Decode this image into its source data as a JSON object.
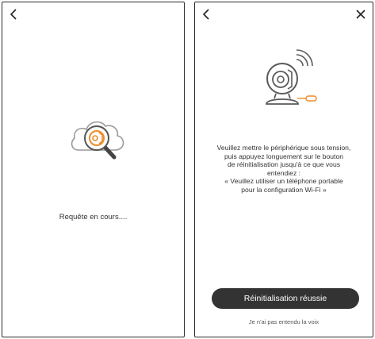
{
  "left_screen": {
    "status_text": "Requête en cours...."
  },
  "right_screen": {
    "instructions": [
      "Veuillez mettre le périphérique sous tension,",
      "puis appuyez longuement sur le bouton",
      "de réinitialisation jusqu'à ce que vous",
      "entendiez :",
      "« Veuillez utiliser un téléphone portable",
      "pour la configuration Wi-Fi »"
    ],
    "primary_button": "Réinitialisation réussie",
    "secondary_link": "Je n'ai pas entendu la voix"
  },
  "colors": {
    "accent": "#F08C2A",
    "button_bg": "#333333",
    "icon_gray": "#5a5a5a"
  },
  "icons": [
    "back-arrow-icon",
    "close-icon",
    "cloud-search-icon",
    "camera-reset-icon"
  ]
}
